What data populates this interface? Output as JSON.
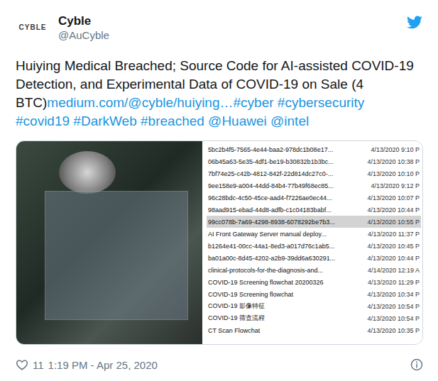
{
  "account": {
    "logo": "CYBLE",
    "name": "Cyble",
    "handle": "@AuCyble"
  },
  "tweet": {
    "segments": [
      {
        "text": "Huiying Medical Breached; Source Code for AI-assisted COVID-19 Detection, and Experimental Data of COVID-19 on Sale (4 BTC)",
        "link": false
      },
      {
        "text": "medium.com/@cyble/huiying…",
        "link": true
      },
      {
        "text": "#cyber",
        "link": true
      },
      {
        "text": " ",
        "link": false
      },
      {
        "text": "#cybersecurity",
        "link": true
      },
      {
        "text": " ",
        "link": false
      },
      {
        "text": "#covid19",
        "link": true
      },
      {
        "text": " ",
        "link": false
      },
      {
        "text": "#DarkWeb",
        "link": true
      },
      {
        "text": " ",
        "link": false
      },
      {
        "text": "#breached",
        "link": true
      },
      {
        "text": " ",
        "link": false
      },
      {
        "text": "@Huawei",
        "link": true
      },
      {
        "text": " ",
        "link": false
      },
      {
        "text": "@intel",
        "link": true
      }
    ]
  },
  "media": {
    "files": [
      {
        "name": "5bc2b4f5-7565-4e44-baa2-978dc1b08e17...",
        "date": "4/13/2020 9:10 P",
        "selected": false
      },
      {
        "name": "06b45a63-5e35-4df1-be19-b30832b1b3bc...",
        "date": "4/13/2020 10:38 P",
        "selected": false
      },
      {
        "name": "7bf74e25-c42b-4812-842f-22d814dc27c0-...",
        "date": "4/13/2020 10:10 P",
        "selected": false
      },
      {
        "name": "9ee158e9-a004-44dd-84b4-77b49f68ec85...",
        "date": "4/13/2020 9:12 P",
        "selected": false
      },
      {
        "name": "96c28bdc-4c50-45ce-aad4-f7226ae0ec44...",
        "date": "4/13/2020 10:07 P",
        "selected": false
      },
      {
        "name": "98aad915-ebad-44d8-adfb-c1c04183babf...",
        "date": "4/13/2020 10:44 P",
        "selected": false
      },
      {
        "name": "99cc078b-7a69-4298-8938-6078292be7b3...",
        "date": "4/13/2020 10:55 P",
        "selected": true
      },
      {
        "name": "AI Front Gateway Server manual deploy...",
        "date": "4/13/2020 11:37 P",
        "selected": false
      },
      {
        "name": "b1264e41-00cc-44a1-8ed3-a017d76c1ab5...",
        "date": "4/13/2020 10:45 P",
        "selected": false
      },
      {
        "name": "ba01a00c-8d45-4202-a2b9-39dd6a630291...",
        "date": "4/13/2020 10:44 P",
        "selected": false
      },
      {
        "name": "clinical-protocols-for-the-diagnosis-and...",
        "date": "4/14/2020 12:19 A",
        "selected": false
      },
      {
        "name": "COVID-19 Screening flowchat 20200326",
        "date": "4/13/2020 11:29 P",
        "selected": false
      },
      {
        "name": "COVID-19 Screening flowchat",
        "date": "4/13/2020 10:34 P",
        "selected": false
      },
      {
        "name": "COVID-19 影像特征",
        "date": "4/13/2020 10:54 P",
        "selected": false
      },
      {
        "name": "COVID-19 筛查流程",
        "date": "4/13/2020 10:54 P",
        "selected": false
      },
      {
        "name": "CT Scan Flowchat",
        "date": "4/13/2020 10:35 P",
        "selected": false
      }
    ]
  },
  "footer": {
    "likes": "11",
    "time": "1:19 PM - Apr 25, 2020"
  }
}
